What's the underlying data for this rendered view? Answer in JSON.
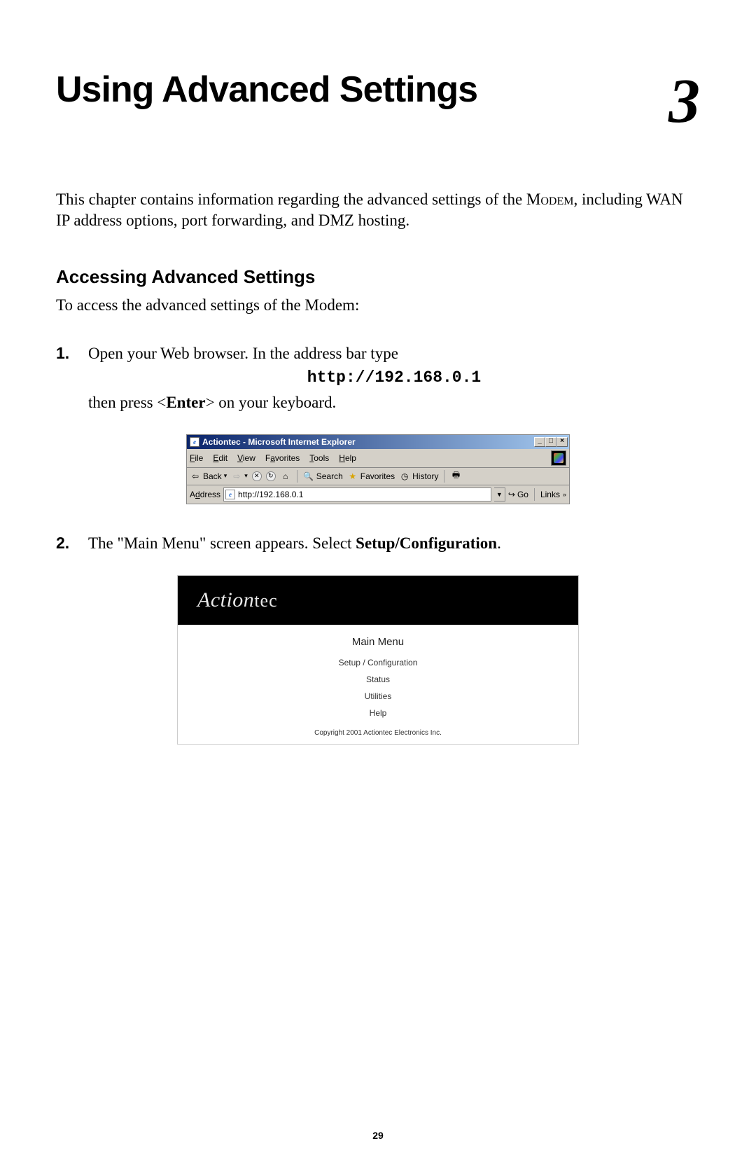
{
  "chapter": {
    "title": "Using Advanced Settings",
    "number": "3"
  },
  "intro_text": {
    "part1": "This chapter contains information regarding the advanced settings of the ",
    "modem": "Modem",
    "part2": ", including WAN IP address options, port forwarding, and ",
    "dmz": "DMZ",
    "part3": " hosting."
  },
  "section": {
    "heading": "Accessing Advanced Settings",
    "intro": "To access the advanced settings of the Modem:"
  },
  "steps": {
    "s1": {
      "num": "1.",
      "line1": "Open your Web browser. In the address bar type",
      "url": "http://192.168.0.1",
      "line2a": "then press <",
      "enter": "Enter",
      "line2b": "> on your keyboard."
    },
    "s2": {
      "num": "2.",
      "text_a": "The \"Main Menu\" screen appears. Select ",
      "text_b": "Setup/Configuration",
      "text_c": "."
    }
  },
  "ie": {
    "title": "Actiontec - Microsoft Internet Explorer",
    "win_min": "_",
    "win_max": "□",
    "win_close": "×",
    "menus": {
      "file": "File",
      "edit": "Edit",
      "view": "View",
      "favorites": "Favorites",
      "tools": "Tools",
      "help": "Help"
    },
    "toolbar": {
      "back": "Back",
      "back_arrow": "⇦",
      "back_drop": "▾",
      "fwd_arrow": "⇨",
      "fwd_drop": "▾",
      "stop": "✕",
      "refresh": "↻",
      "home": "⌂",
      "search_ico": "🔍",
      "search": "Search",
      "fav_ico": "★",
      "favorites": "Favorites",
      "hist_ico": "◷",
      "history": "History",
      "print_ico": "🖶"
    },
    "address": {
      "label": "Address",
      "value": "http://192.168.0.1",
      "drop": "▼",
      "go_ico": "↪",
      "go": "Go",
      "links": "Links",
      "chev": "»"
    }
  },
  "mainmenu": {
    "logo_a": "Action",
    "logo_b": "tec",
    "title": "Main Menu",
    "items": [
      "Setup / Configuration",
      "Status",
      "Utilities",
      "Help"
    ],
    "copyright": "Copyright 2001 Actiontec Electronics Inc."
  },
  "page_number": "29"
}
